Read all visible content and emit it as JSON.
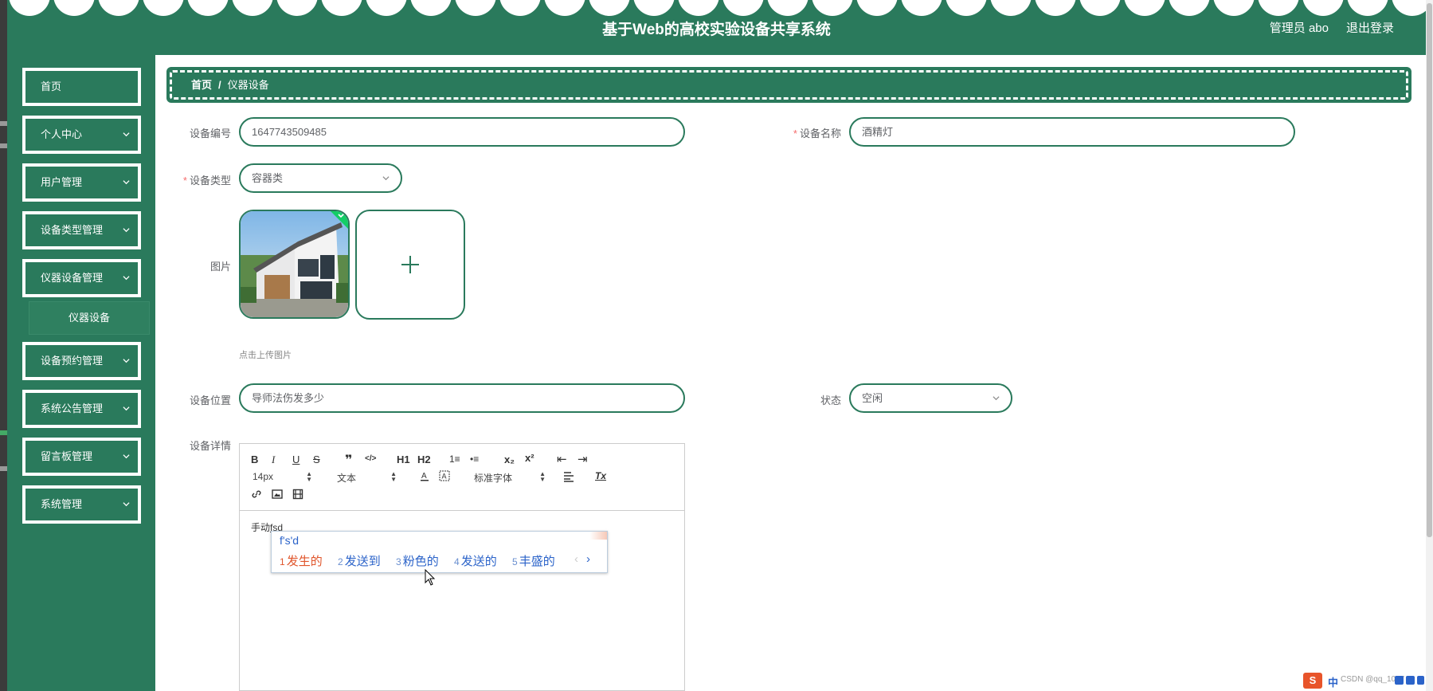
{
  "header": {
    "title": "基于Web的高校实验设备共享系统",
    "admin": "管理员 abo",
    "logout": "退出登录"
  },
  "sidebar": {
    "items": [
      {
        "label": "首页",
        "has_arrow": false
      },
      {
        "label": "个人中心",
        "has_arrow": true
      },
      {
        "label": "用户管理",
        "has_arrow": true
      },
      {
        "label": "设备类型管理",
        "has_arrow": true
      },
      {
        "label": "仪器设备管理",
        "has_arrow": true
      },
      {
        "label": "设备预约管理",
        "has_arrow": true
      },
      {
        "label": "系统公告管理",
        "has_arrow": true
      },
      {
        "label": "留言板管理",
        "has_arrow": true
      },
      {
        "label": "系统管理",
        "has_arrow": true
      }
    ],
    "submenu": {
      "label": "仪器设备"
    }
  },
  "breadcrumb": {
    "home": "首页",
    "separator": "/",
    "current": "仪器设备"
  },
  "form": {
    "device_no": {
      "label": "设备编号",
      "value": "1647743509485"
    },
    "device_name": {
      "label": "设备名称",
      "value": "酒精灯",
      "required": "*"
    },
    "device_type": {
      "label": "设备类型",
      "value": "容器类",
      "required": "*"
    },
    "image": {
      "label": "图片",
      "tip": "点击上传图片"
    },
    "location": {
      "label": "设备位置",
      "value": "导师法伤发多少"
    },
    "status": {
      "label": "状态",
      "value": "空闲"
    },
    "detail": {
      "label": "设备详情"
    }
  },
  "editor": {
    "toolbar": {
      "bold": "B",
      "italic": "I",
      "underline": "U",
      "strike": "S",
      "quote": "❞",
      "code": "</>",
      "h1": "H1",
      "h2": "H2",
      "ordered_list": "1≡",
      "bullet_list": "•≡",
      "subscript": "x₂",
      "superscript": "x²",
      "outdent": "⇤",
      "indent": "⇥",
      "font_size": "14px",
      "text_type": "文本",
      "font_family": "标准字体",
      "clear_format": "Tx"
    },
    "content_text": "手动",
    "composing": "fsd"
  },
  "ime": {
    "composition": "f's'd",
    "candidates": [
      {
        "n": "1",
        "text": "发生的"
      },
      {
        "n": "2",
        "text": "发送到"
      },
      {
        "n": "3",
        "text": "粉色的"
      },
      {
        "n": "4",
        "text": "发送的"
      },
      {
        "n": "5",
        "text": "丰盛的"
      }
    ],
    "prev": "‹",
    "next": "›"
  },
  "tray": {
    "logo": "S",
    "lang": "中",
    "watermark": "CSDN @qq_1047"
  },
  "colors": {
    "primary": "#2a7a5c",
    "required": "#f56c6c",
    "ime_active": "#e0552b",
    "ime_text": "#2b63c9"
  }
}
